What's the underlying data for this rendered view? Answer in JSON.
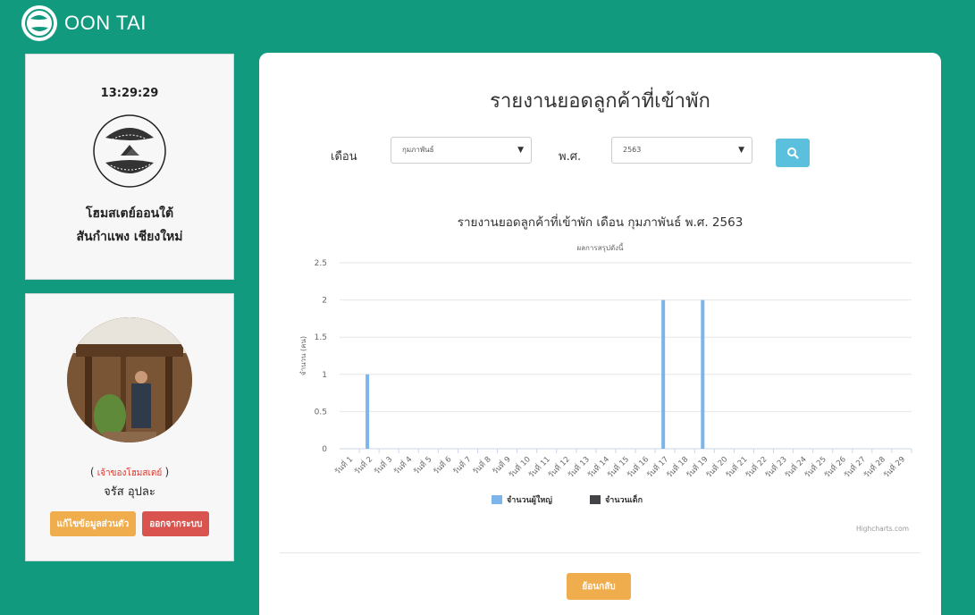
{
  "brand": {
    "name": "OON TAI"
  },
  "info": {
    "clock": "13:29:29",
    "home_line1": "โฮมสเตย์ออนใต้",
    "home_line2": "สันกำแพง เชียงใหม่"
  },
  "user": {
    "role_open": "(",
    "role": "เจ้าของโฮมสเตย์",
    "role_close": ")",
    "name": "จรัส อุปละ",
    "edit_label": "แก้ไขข้อมูลส่วนตัว",
    "logout_label": "ออกจากระบบ"
  },
  "report": {
    "title": "รายงานยอดลูกค้าที่เข้าพัก",
    "month_label": "เดือน",
    "month_value": "กุมภาพันธ์",
    "year_label": "พ.ศ.",
    "year_value": "2563",
    "back_label": "ย้อนกลับ",
    "credit": "Highcharts.com"
  },
  "colors": {
    "accent": "#119a7e",
    "adult_series": "#7cb5ec",
    "child_series": "#434348"
  },
  "icons": {
    "search": "search-icon",
    "dropdown": "caret-down-icon"
  },
  "chart_data": {
    "type": "bar",
    "title": "รายงานยอดลูกค้าที่เข้าพัก เดือน กุมภาพันธ์ พ.ศ. 2563",
    "subtitle": "ผลการสรุปดังนี้",
    "ylabel": "จำนวน (คน)",
    "ylim": [
      0,
      2.5
    ],
    "yticks": [
      0,
      0.5,
      1,
      1.5,
      2,
      2.5
    ],
    "grid": true,
    "legend": "bottom-center",
    "categories": [
      "วันที่ 1",
      "วันที่ 2",
      "วันที่ 3",
      "วันที่ 4",
      "วันที่ 5",
      "วันที่ 6",
      "วันที่ 7",
      "วันที่ 8",
      "วันที่ 9",
      "วันที่ 10",
      "วันที่ 11",
      "วันที่ 12",
      "วันที่ 13",
      "วันที่ 14",
      "วันที่ 15",
      "วันที่ 16",
      "วันที่ 17",
      "วันที่ 18",
      "วันที่ 19",
      "วันที่ 20",
      "วันที่ 21",
      "วันที่ 22",
      "วันที่ 23",
      "วันที่ 24",
      "วันที่ 25",
      "วันที่ 26",
      "วันที่ 27",
      "วันที่ 28",
      "วันที่ 29"
    ],
    "series": [
      {
        "name": "จำนวนผู้ใหญ่",
        "values": [
          0,
          1,
          0,
          0,
          0,
          0,
          0,
          0,
          0,
          0,
          0,
          0,
          0,
          0,
          0,
          0,
          2,
          0,
          2,
          0,
          0,
          0,
          0,
          0,
          0,
          0,
          0,
          0,
          0
        ]
      },
      {
        "name": "จำนวนเด็ก",
        "values": [
          0,
          0,
          0,
          0,
          0,
          0,
          0,
          0,
          0,
          0,
          0,
          0,
          0,
          0,
          0,
          0,
          0,
          0,
          0,
          0,
          0,
          0,
          0,
          0,
          0,
          0,
          0,
          0,
          0
        ]
      }
    ]
  }
}
